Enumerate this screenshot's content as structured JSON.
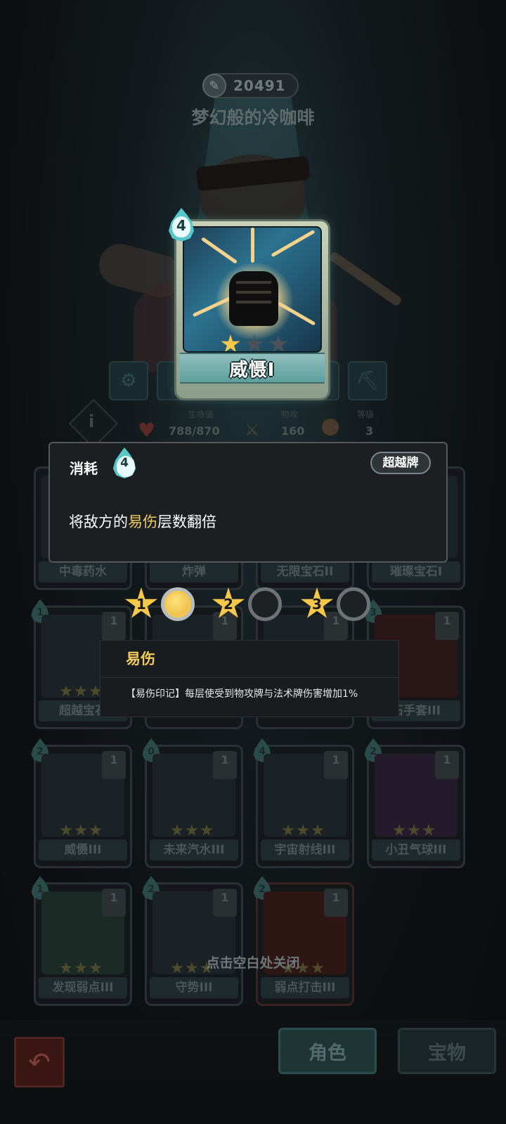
{
  "header": {
    "score": "20491",
    "player_name": "梦幻般的冷咖啡"
  },
  "stats": {
    "info_icon": "i",
    "hp_label": "生命值",
    "hp_value": "788/870",
    "attack_label": "物攻",
    "attack_value": "160",
    "level_label": "等级",
    "level_value": "3"
  },
  "focused_card": {
    "name": "威慑I",
    "cost": "4",
    "stars_filled": 1,
    "stars_total": 3
  },
  "card_tooltip": {
    "cost_label": "消耗",
    "cost_value": "4",
    "badge": "超越牌",
    "desc_prefix": "将敌方的",
    "desc_keyword": "易伤",
    "desc_suffix": "层数翻倍"
  },
  "upgrade_levels": [
    {
      "num": "1",
      "active": true
    },
    {
      "num": "2",
      "active": false
    },
    {
      "num": "3",
      "active": false
    }
  ],
  "keyword_tooltip": {
    "title": "易伤",
    "body": "【易伤印记】每层使受到物攻牌与法术牌伤害增加1%"
  },
  "deck_cards": {
    "row1": [
      "中毒药水",
      "炸弹",
      "无限宝石II",
      "璀璨宝石I"
    ],
    "row2": [
      "超越宝石",
      "",
      "",
      "石手套III"
    ],
    "row2_costs": [
      "1",
      "",
      "",
      "3"
    ],
    "row3": [
      "威慑III",
      "未来汽水III",
      "宇宙射线III",
      "小丑气球III"
    ],
    "row3_costs": [
      "2",
      "0",
      "4",
      "2"
    ],
    "row4": [
      "发现弱点III",
      "守势III",
      "弱点打击III"
    ],
    "row4_costs": [
      "1",
      "2",
      "2"
    ],
    "count": "1"
  },
  "close_hint": "点击空白处关闭",
  "bottom_nav": {
    "back_icon": "return-arrow-icon",
    "character": "角色",
    "treasure": "宝物"
  },
  "colors": {
    "accent_gold": "#f2cc5c",
    "cost_teal": "#57c7c9"
  }
}
